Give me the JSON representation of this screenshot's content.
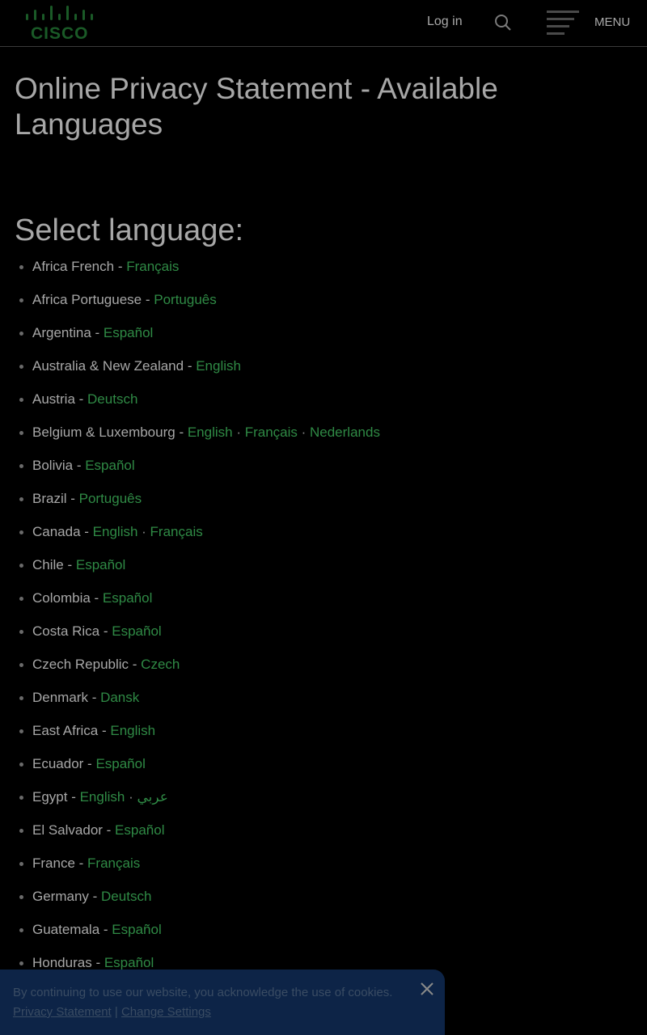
{
  "header": {
    "logo_text": "CISCO",
    "login_label": "Log in",
    "search_icon": "search-icon",
    "menu_icon": "hamburger-icon",
    "menu_label": "MENU"
  },
  "page": {
    "title": "Online Privacy Statement - Available Languages",
    "section_heading": "Select language:"
  },
  "languages": [
    {
      "region": "Africa French",
      "links": [
        "Français"
      ]
    },
    {
      "region": "Africa Portuguese",
      "links": [
        "Português"
      ]
    },
    {
      "region": "Argentina",
      "links": [
        "Español"
      ]
    },
    {
      "region": "Australia & New Zealand",
      "links": [
        "English"
      ]
    },
    {
      "region": "Austria",
      "links": [
        "Deutsch"
      ]
    },
    {
      "region": "Belgium & Luxembourg",
      "links": [
        "English",
        "Français",
        "Nederlands"
      ]
    },
    {
      "region": "Bolivia",
      "links": [
        "Español"
      ]
    },
    {
      "region": "Brazil",
      "links": [
        "Português"
      ]
    },
    {
      "region": "Canada",
      "links": [
        "English",
        "Français"
      ]
    },
    {
      "region": "Chile",
      "links": [
        "Español"
      ]
    },
    {
      "region": "Colombia",
      "links": [
        "Español"
      ]
    },
    {
      "region": "Costa Rica",
      "links": [
        "Español"
      ]
    },
    {
      "region": "Czech Republic",
      "links": [
        "Czech"
      ]
    },
    {
      "region": "Denmark",
      "links": [
        "Dansk"
      ]
    },
    {
      "region": "East Africa",
      "links": [
        "English"
      ]
    },
    {
      "region": "Ecuador",
      "links": [
        "Español"
      ]
    },
    {
      "region": "Egypt",
      "links": [
        "English",
        "عربي"
      ]
    },
    {
      "region": "El Salvador",
      "links": [
        "Español"
      ]
    },
    {
      "region": "France",
      "links": [
        "Français"
      ]
    },
    {
      "region": "Germany",
      "links": [
        "Deutsch"
      ]
    },
    {
      "region": "Guatemala",
      "links": [
        "Español"
      ]
    },
    {
      "region": "Honduras",
      "links": [
        "Español"
      ]
    }
  ],
  "separators": {
    "dash": " - ",
    "dot": " · "
  },
  "cookie_banner": {
    "text": "By continuing to use our website, you acknowledge the use of cookies.",
    "privacy_link": "Privacy Statement",
    "divider": "|",
    "settings_link": "Change Settings",
    "close_icon": "close-icon"
  },
  "colors": {
    "background": "#000000",
    "link": "#2f8a45",
    "text": "#a7a7a7",
    "cookie_bg": "#0d2447"
  }
}
